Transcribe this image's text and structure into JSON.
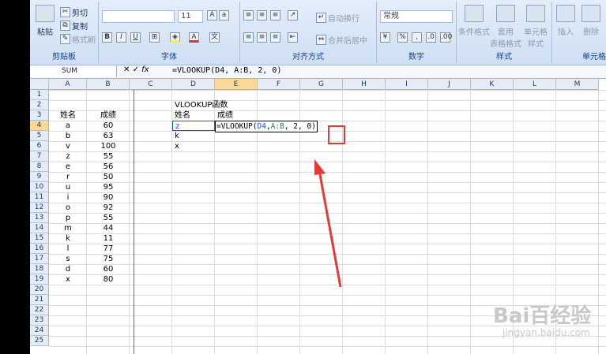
{
  "ribbon": {
    "clipboard": {
      "paste": "粘贴",
      "cut": "剪切",
      "copy": "复制",
      "format_painter": "格式刷",
      "group_label": "剪贴板"
    },
    "font": {
      "font_name": "",
      "font_size": "11",
      "bold": "B",
      "italic": "I",
      "underline": "U",
      "group_label": "字体"
    },
    "alignment": {
      "wrap_text": "自动换行",
      "merge_center": "合并后居中",
      "group_label": "对齐方式"
    },
    "number": {
      "format": "常规",
      "group_label": "数字"
    },
    "styles": {
      "conditional": "条件格式",
      "table_format": "套用\n表格格式",
      "cell_styles": "单元格\n样式",
      "group_label": "样式"
    },
    "cells": {
      "insert": "插入",
      "delete": "删除",
      "group_label": "单元格"
    }
  },
  "formula_bar": {
    "name_box": "SUM",
    "formula": "=VLOOKUP(D4, A:B, 2, 0)",
    "fx": "fx"
  },
  "columns": [
    "A",
    "B",
    "C",
    "D",
    "E",
    "F",
    "G",
    "H",
    "I",
    "J",
    "K",
    "L",
    "M"
  ],
  "rows": [
    "1",
    "2",
    "3",
    "4",
    "5",
    "6",
    "7",
    "8",
    "9",
    "10",
    "11",
    "12",
    "13",
    "14",
    "15",
    "16",
    "17",
    "18",
    "19",
    "20",
    "21",
    "22",
    "23",
    "24",
    "25"
  ],
  "sheet": {
    "header_a": "姓名",
    "header_b": "成绩",
    "names": [
      "a",
      "b",
      "v",
      "z",
      "e",
      "r",
      "u",
      "i",
      "o",
      "p",
      "m",
      "k",
      "l",
      "s",
      "d",
      "x"
    ],
    "scores": [
      "60",
      "63",
      "100",
      "55",
      "56",
      "50",
      "95",
      "90",
      "92",
      "55",
      "44",
      "11",
      "77",
      "75",
      "60",
      "80"
    ],
    "vlookup_title": "VLOOKUP函数",
    "lookup_header_name": "姓名",
    "lookup_header_score": "成绩",
    "lookup_names": [
      "z",
      "k",
      "x"
    ],
    "edit_formula_parts": {
      "pre": "=VLOOKUP(",
      "ref1": "D4",
      "sep1": ",",
      "ref2": "A:B",
      "sep2": ", 2, 0)"
    }
  },
  "watermark": {
    "main": "Bai百经验",
    "sub": "jingyan.baidu.com"
  },
  "colors": {
    "ref1": "#1f4fd1",
    "ref2": "#1a8a3a",
    "accent_red": "#e53935"
  }
}
